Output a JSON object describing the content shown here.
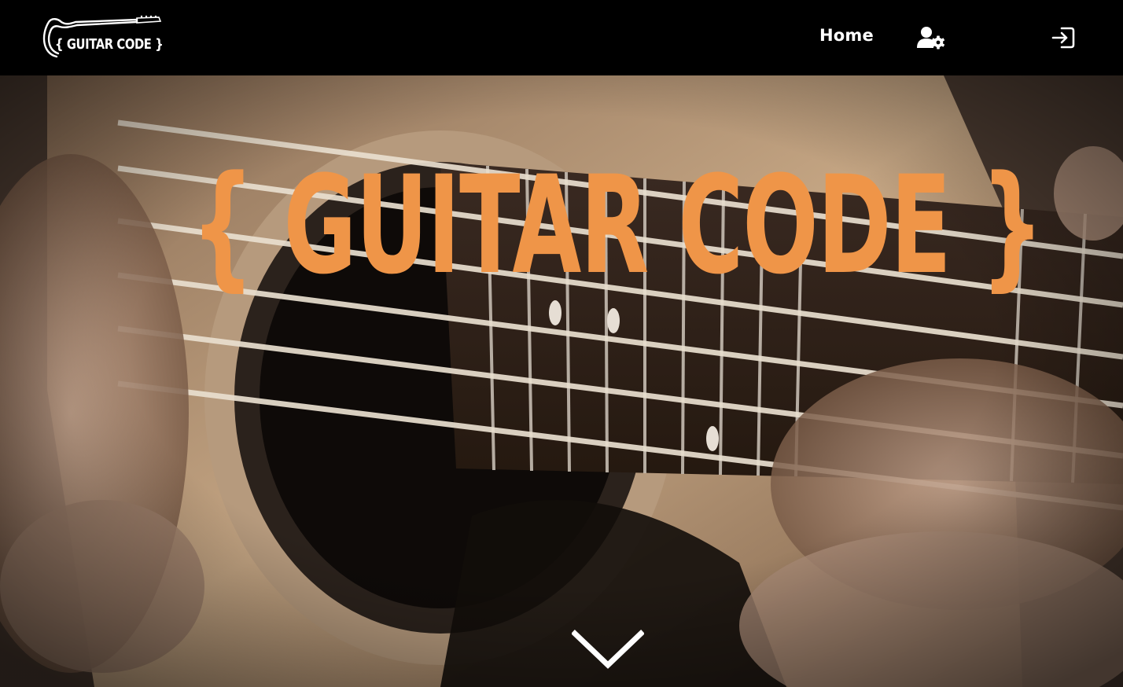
{
  "header": {
    "logo_text": "{ GUITAR CODE }",
    "nav": {
      "home_label": "Home",
      "admin_icon": "user-cog-icon",
      "login_icon": "sign-in-icon"
    }
  },
  "hero": {
    "title": "{ GUITAR CODE }",
    "scroll_icon": "chevron-down-icon",
    "background": "acoustic-guitar-photo"
  },
  "colors": {
    "nav_background": "#000000",
    "accent": "#ef9548",
    "nav_text": "#ffffff"
  }
}
